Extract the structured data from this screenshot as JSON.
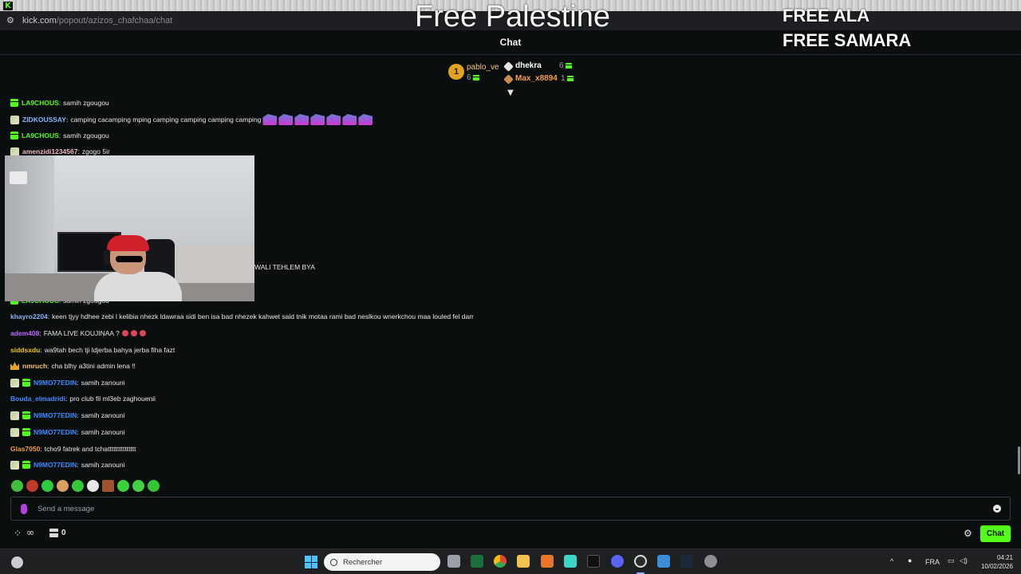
{
  "browser": {
    "url_host": "kick.com",
    "url_path": "/popout/azizos_chafchaa/chat"
  },
  "overlay": {
    "title": "Free Palestine",
    "right_line1": "FREE ALA",
    "right_line2": "FREE SAMARA"
  },
  "chat": {
    "header_title": "Chat",
    "leaderboard": {
      "first": {
        "rank": "1",
        "name": "pablo_ve",
        "count": "6"
      },
      "second": {
        "name": "dhekra",
        "count": "6"
      },
      "third": {
        "name": "Max_x8894",
        "count": "1"
      }
    },
    "messages": [
      {
        "user": "LA9CHOUS",
        "text": "samih zgougou",
        "user_color": "#53fc18",
        "badges": [
          "gift"
        ]
      },
      {
        "user": "ZIDKOUSSAY",
        "text": "camping cacamping mping camping camping camping camping",
        "user_color": "#8ab4f8",
        "badges": [
          "sub"
        ]
      },
      {
        "user": "LA9CHOUS",
        "text": "samih zgougou",
        "user_color": "#53fc18",
        "badges": [
          "gift"
        ]
      },
      {
        "user": "amenzidi1234567",
        "text": "zgogo 5ir",
        "user_color": "#f3b8c0",
        "badges": [
          "sub"
        ]
      },
      {
        "user": "",
        "text": "WALI TEHLEM BYA",
        "user_color": "#e6e6e6",
        "badges": []
      },
      {
        "user": "LA9CHOUS",
        "text": "samih zgougou",
        "user_color": "#53fc18",
        "badges": [
          "gift"
        ]
      },
      {
        "user": "khayro2204",
        "text": "keen tjyy hdhee zebi l kelibia nhezk ldawraa sidi ben isa bad nhezek kahwet said tnik motaa rami bad neslkou wnerkchou maa louled fel darr",
        "user_color": "#8ab4f8",
        "badges": []
      },
      {
        "user": "adem408",
        "text": "FAMA LIVE KOUJINAA ?",
        "user_color": "#c266ff",
        "badges": []
      },
      {
        "user": "siddsxdu",
        "text": "wa9tah bech tji ldjerba bahya jerba fiha fazt",
        "user_color": "#f1c40f",
        "badges": []
      },
      {
        "user": "nmruch",
        "text": "cha blhy a3tini admin lena !!",
        "user_color": "#f5c26b",
        "badges": [
          "crown"
        ]
      },
      {
        "user": "N9MO77EDIN",
        "text": "samih zanouni",
        "user_color": "#3b8cff",
        "badges": [
          "sub",
          "gift"
        ]
      },
      {
        "user": "Bouda_elmadridi",
        "text": "pro club fil ml3eb zaghouenii",
        "user_color": "#3b8cff",
        "badges": []
      },
      {
        "user": "N9MO77EDIN",
        "text": "samih zanouni",
        "user_color": "#3b8cff",
        "badges": [
          "sub",
          "gift"
        ]
      },
      {
        "user": "N9MO77EDIN",
        "text": "samih zanouni",
        "user_color": "#3b8cff",
        "badges": [
          "sub",
          "gift"
        ]
      },
      {
        "user": "Glas7050",
        "text": "tcho9 fatrek and tchattttttttttttttt",
        "user_color": "#f39c4a",
        "badges": []
      },
      {
        "user": "N9MO77EDIN",
        "text": "samih zanouni",
        "user_color": "#3b8cff",
        "badges": [
          "sub",
          "gift"
        ]
      }
    ],
    "input_placeholder": "Send a message",
    "gift_count": "0",
    "chat_button": "Chat"
  },
  "taskbar": {
    "search_label": "Rechercher",
    "language": "FRA",
    "time": "04:21",
    "date": "10/02/2026"
  },
  "colors": {
    "kick_green": "#53fc18",
    "background": "#0b0e0f"
  }
}
